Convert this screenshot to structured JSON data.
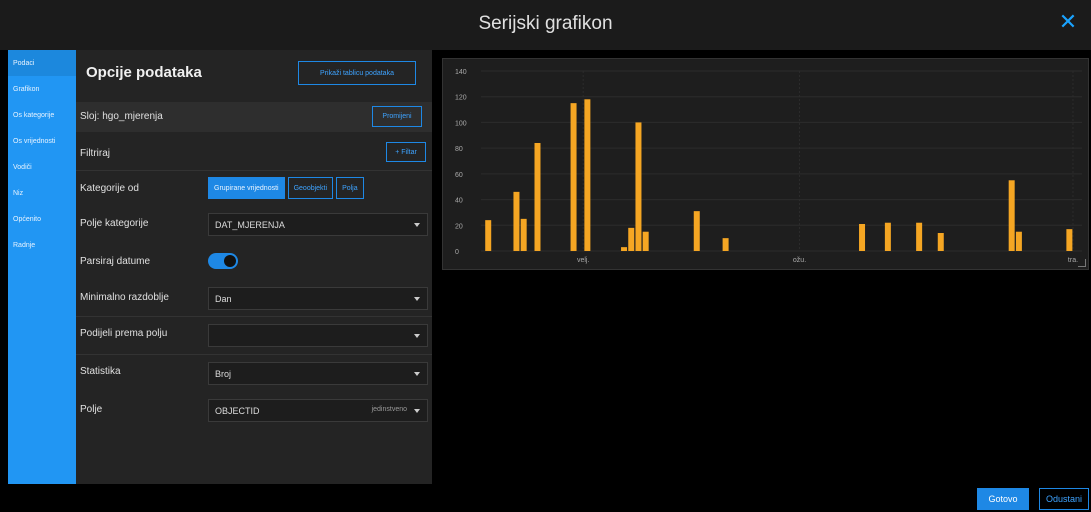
{
  "dialog": {
    "title": "Serijski grafikon",
    "close_icon": "close-icon"
  },
  "sidebar": {
    "items": [
      {
        "label": "Podaci",
        "active": true
      },
      {
        "label": "Grafikon"
      },
      {
        "label": "Os kategorije"
      },
      {
        "label": "Os vrijednosti"
      },
      {
        "label": "Vodiči"
      },
      {
        "label": "Niz"
      },
      {
        "label": "Općenito"
      },
      {
        "label": "Radnje"
      }
    ]
  },
  "panel": {
    "heading": "Opcije podataka",
    "show_table_button": "Prikaži tablicu podataka",
    "layer_label": "Sloj: hgo_mjerenja",
    "change_button": "Promijeni",
    "filter_label": "Filtriraj",
    "add_filter_button": "+ Filtar",
    "category_from_label": "Kategorije od",
    "category_from_options": [
      "Grupirane vrijednosti",
      "Geoobjekti",
      "Polja"
    ],
    "category_from_selected": "Grupirane vrijednosti",
    "category_field_label": "Polje kategorije",
    "category_field_value": "DAT_MJERENJA",
    "parse_dates_label": "Parsiraj datume",
    "parse_dates_on": true,
    "min_period_label": "Minimalno razdoblje",
    "min_period_value": "Dan",
    "split_by_label": "Podijeli prema polju",
    "split_by_value": "",
    "statistic_label": "Statistika",
    "statistic_value": "Broj",
    "field_label": "Polje",
    "field_value": "OBJECTID",
    "field_suffix": "jedinstveno"
  },
  "footer": {
    "done_button": "Gotovo",
    "cancel_button": "Odustani"
  },
  "colors": {
    "accent": "#1e88e5",
    "bar": "#f5a623",
    "sidebar": "#2196f3"
  },
  "chart_data": {
    "type": "bar",
    "x_unit": "day index from first visible tick region",
    "y_ticks": [
      0,
      20,
      40,
      60,
      80,
      100,
      120,
      140
    ],
    "ylim": [
      0,
      140
    ],
    "x_tick_labels": [
      {
        "label": "velj.",
        "at": 0.17
      },
      {
        "label": "ožu.",
        "at": 0.53
      },
      {
        "label": "tra.",
        "at": 0.985
      }
    ],
    "bars": [
      {
        "x": 0.012,
        "value": 24
      },
      {
        "x": 0.059,
        "value": 46
      },
      {
        "x": 0.071,
        "value": 25
      },
      {
        "x": 0.094,
        "value": 84
      },
      {
        "x": 0.154,
        "value": 115
      },
      {
        "x": 0.177,
        "value": 118
      },
      {
        "x": 0.238,
        "value": 3
      },
      {
        "x": 0.25,
        "value": 18
      },
      {
        "x": 0.262,
        "value": 100
      },
      {
        "x": 0.274,
        "value": 15
      },
      {
        "x": 0.359,
        "value": 31
      },
      {
        "x": 0.407,
        "value": 10
      },
      {
        "x": 0.634,
        "value": 21
      },
      {
        "x": 0.677,
        "value": 22
      },
      {
        "x": 0.729,
        "value": 22
      },
      {
        "x": 0.765,
        "value": 14
      },
      {
        "x": 0.883,
        "value": 55
      },
      {
        "x": 0.895,
        "value": 15
      },
      {
        "x": 0.979,
        "value": 17
      }
    ]
  }
}
